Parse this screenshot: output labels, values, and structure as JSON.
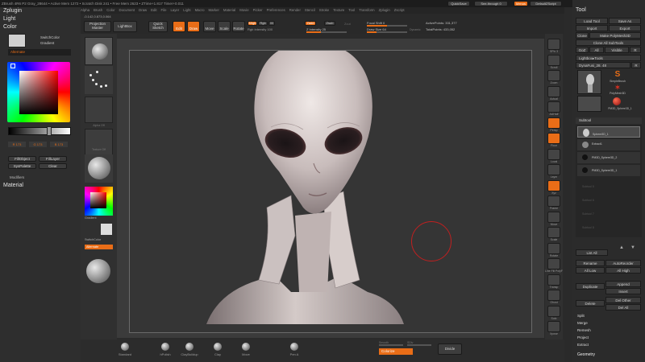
{
  "window": {
    "title": "ZBrush 4R6 P2   Gray_28644   • Active Mem 1272 • Scratch Disk 241 • Free Mem 2623 • ZTime+1.817 Timer+0.011",
    "quicksave": "QuickSave",
    "seethrough": "See-through  0",
    "menus_label": "Menus",
    "defaultzscript": "DefaultZScript"
  },
  "menus": [
    "Alpha",
    "Brush",
    "Color",
    "Document",
    "Draw",
    "Edit",
    "File",
    "Layer",
    "Light",
    "Macro",
    "Marker",
    "Material",
    "Movie",
    "Picker",
    "Preferences",
    "Render",
    "Stencil",
    "Stroke",
    "Texture",
    "Tool",
    "Transform",
    "Zplugin",
    "Zscript"
  ],
  "toolbar": {
    "projection_master": "Projection Master",
    "lightbox": "LightBox",
    "quick_sketch": "Quick Sketch",
    "edit": "Edit",
    "draw": "Draw",
    "move": "Move",
    "scale": "Scale",
    "rotate": "Rotate",
    "mrgb": "Mrgb",
    "rgb": "Rgb",
    "m": "M",
    "rgb_intensity": "Rgb Intensity 100",
    "zadd": "Zadd",
    "zsub": "Zsub",
    "zcut": "Zcut",
    "z_intensity": "Z Intensity 25",
    "focal_shift": "Focal Shift 0",
    "draw_size": "Draw Size 64",
    "dynamic": "Dynamic",
    "active_points": "ActivePoints: 331,377",
    "total_points": "TotalPoints: 433,052",
    "coords": "-0.142,0.873,0.064"
  },
  "left": {
    "zplugin": "Zplugin",
    "light": "Light",
    "color": "Color",
    "switch_color": "SwitchColor",
    "gradient": "Gradient",
    "alternate": "Alternate",
    "r": "R 173",
    "g": "G 173",
    "b": "B 173",
    "fill_object": "FillObject",
    "fill_layer": "FillLayer",
    "sys_palette": "SysPalette",
    "clear": "Clear",
    "modifiers": "Modifiers",
    "material": "Material"
  },
  "shelf": {
    "standard": "Standard",
    "dots": "Dots",
    "alpha_off": "Alpha Off",
    "texture_off": "Texture Off",
    "gradient": "Gradient",
    "switch_color": "SwitchColor",
    "alternate": "Alternate"
  },
  "rightshelf": [
    "SPix 3",
    "Scroll",
    "Zoom",
    "Actual",
    "AAHalf",
    "Persp",
    "Floor",
    "Local",
    "Lsym",
    "Xyz",
    "Frame",
    "Move",
    "Scale",
    "Rotate",
    "Line Fill PolyF",
    "Transp",
    "Ghost",
    "Solo",
    "Xpose"
  ],
  "tool": {
    "title": "Tool",
    "load_tool": "Load Tool",
    "save_as": "Save As",
    "import": "Import",
    "export": "Export",
    "clone": "Clone",
    "make_polymesh": "Make PolyMesh3D",
    "clone_all": "Clone All SubTools",
    "goz": "GoZ",
    "all": "All",
    "visible": "Visible",
    "r": "R",
    "lightbox_tools": "Lightbox▸Tools",
    "dynafusi": "DynaFusi_28. 48",
    "r2": "R",
    "simplebrush": "SimpleBrush",
    "polymesh3d": "PolyMesh3D",
    "pm3d": "PM3D_Sphere3D_1",
    "subtool": "Subtool",
    "st1": "Sphere3D_1",
    "st2": "Extract1",
    "st3": "PM3D_Sphere3D_2",
    "st4": "PM3D_Sphere3D_1",
    "st5": "Subtool 5",
    "st6": "Subtool 6",
    "st7": "Subtool 7",
    "st8": "Subtool 8",
    "list_all": "List All",
    "rename": "Rename",
    "autoreorder": "AutoReorder",
    "all_low": "All Low",
    "all_high": "All High",
    "duplicate": "Duplicate",
    "append": "Append",
    "insert": "Insert",
    "delete": "Delete",
    "del_other": "Del Other",
    "del_all": "Del All",
    "split": "Split",
    "merge": "Merge",
    "remesh": "Remesh",
    "project": "Project",
    "extract": "Extract",
    "geometry": "Geometry"
  },
  "bottom": {
    "brushes": [
      "Standard",
      "hPolish",
      "ClayBuildup",
      "Clay",
      "Move",
      "Pen A"
    ],
    "colorize": "Colorize",
    "divide": "Divide",
    "smooth": "Smooth",
    "sdiv": "SDiv"
  },
  "colors": {
    "accent": "#e96d17",
    "panel": "#2e2e2e",
    "canvas": "#353535"
  }
}
